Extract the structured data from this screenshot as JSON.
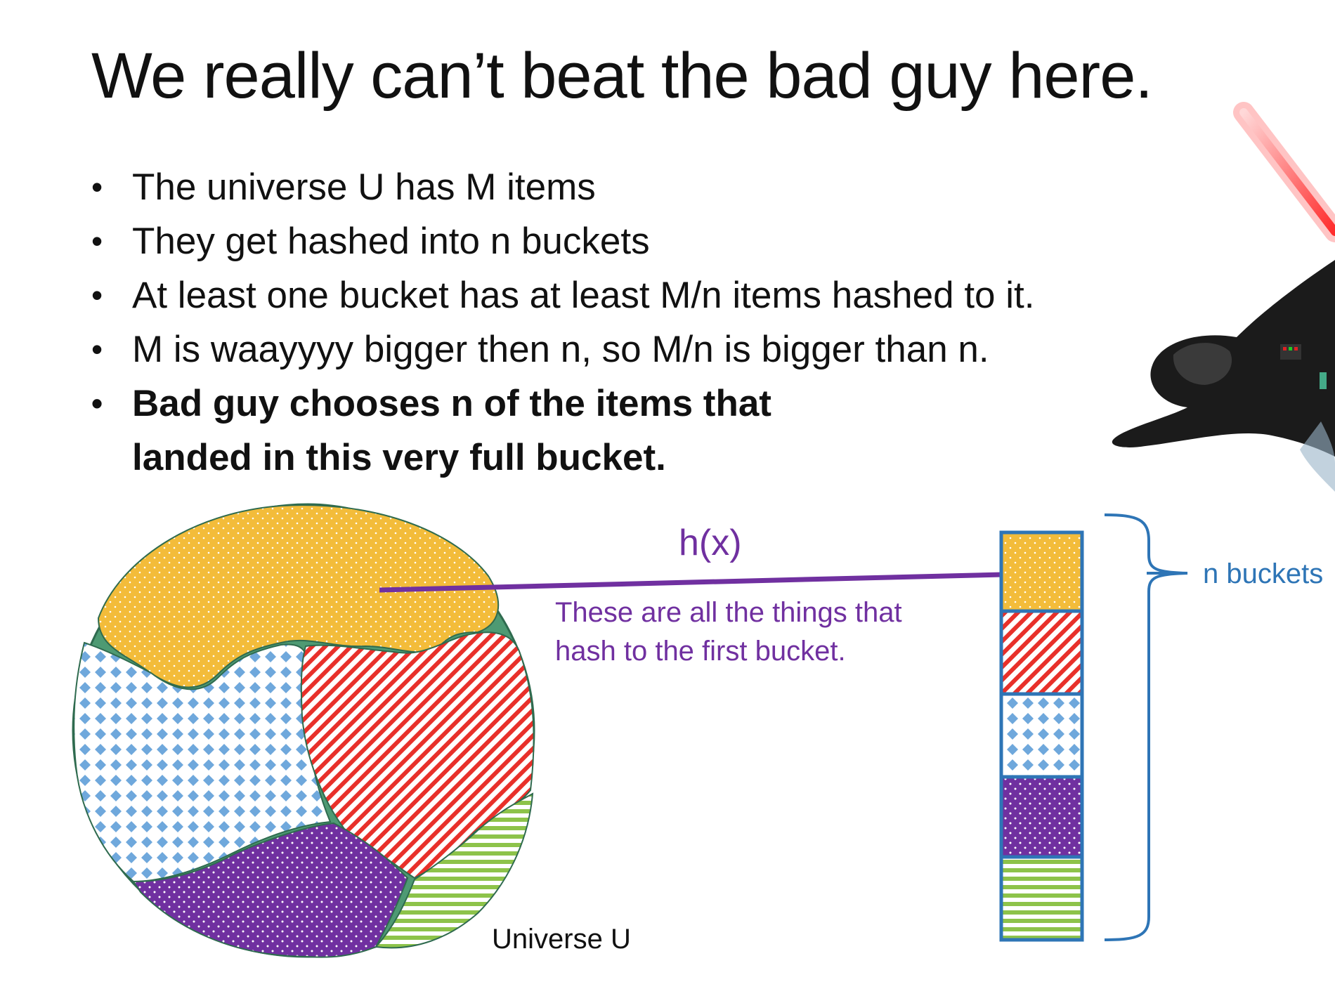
{
  "slide": {
    "title": "We really can’t beat the bad guy here.",
    "bullets": [
      {
        "text": "The universe U has M items",
        "bold": false
      },
      {
        "text": "They get hashed into n buckets",
        "bold": false
      },
      {
        "text": "At least one bucket has at least M/n items hashed to it.",
        "bold": false
      },
      {
        "text": "M is waayyyy bigger then n, so M/n is bigger than n.",
        "bold": false
      },
      {
        "text": "Bad guy chooses n of the items that landed in this very full bucket.",
        "bold": true
      }
    ],
    "bullet_glyph": "•"
  },
  "diagram": {
    "hash_label": "h(x)",
    "annotation_line1": "These are all the things that",
    "annotation_line2": "hash to the first bucket.",
    "universe_label": "Universe U",
    "buckets_label": "n buckets",
    "colors": {
      "yellow": "#F3BC3A",
      "red": "#E8302A",
      "blue": "#6FA8DC",
      "purple": "#7030A0",
      "green": "#8DC34A",
      "outline_green": "#3A7A5A",
      "bucket_border": "#2E75B6",
      "arrow_purple": "#7030A0",
      "brace_blue": "#2E75B6",
      "label_blue": "#2E75B6"
    },
    "bucket_fills": [
      "yellow",
      "red",
      "blue",
      "purple",
      "green"
    ]
  }
}
